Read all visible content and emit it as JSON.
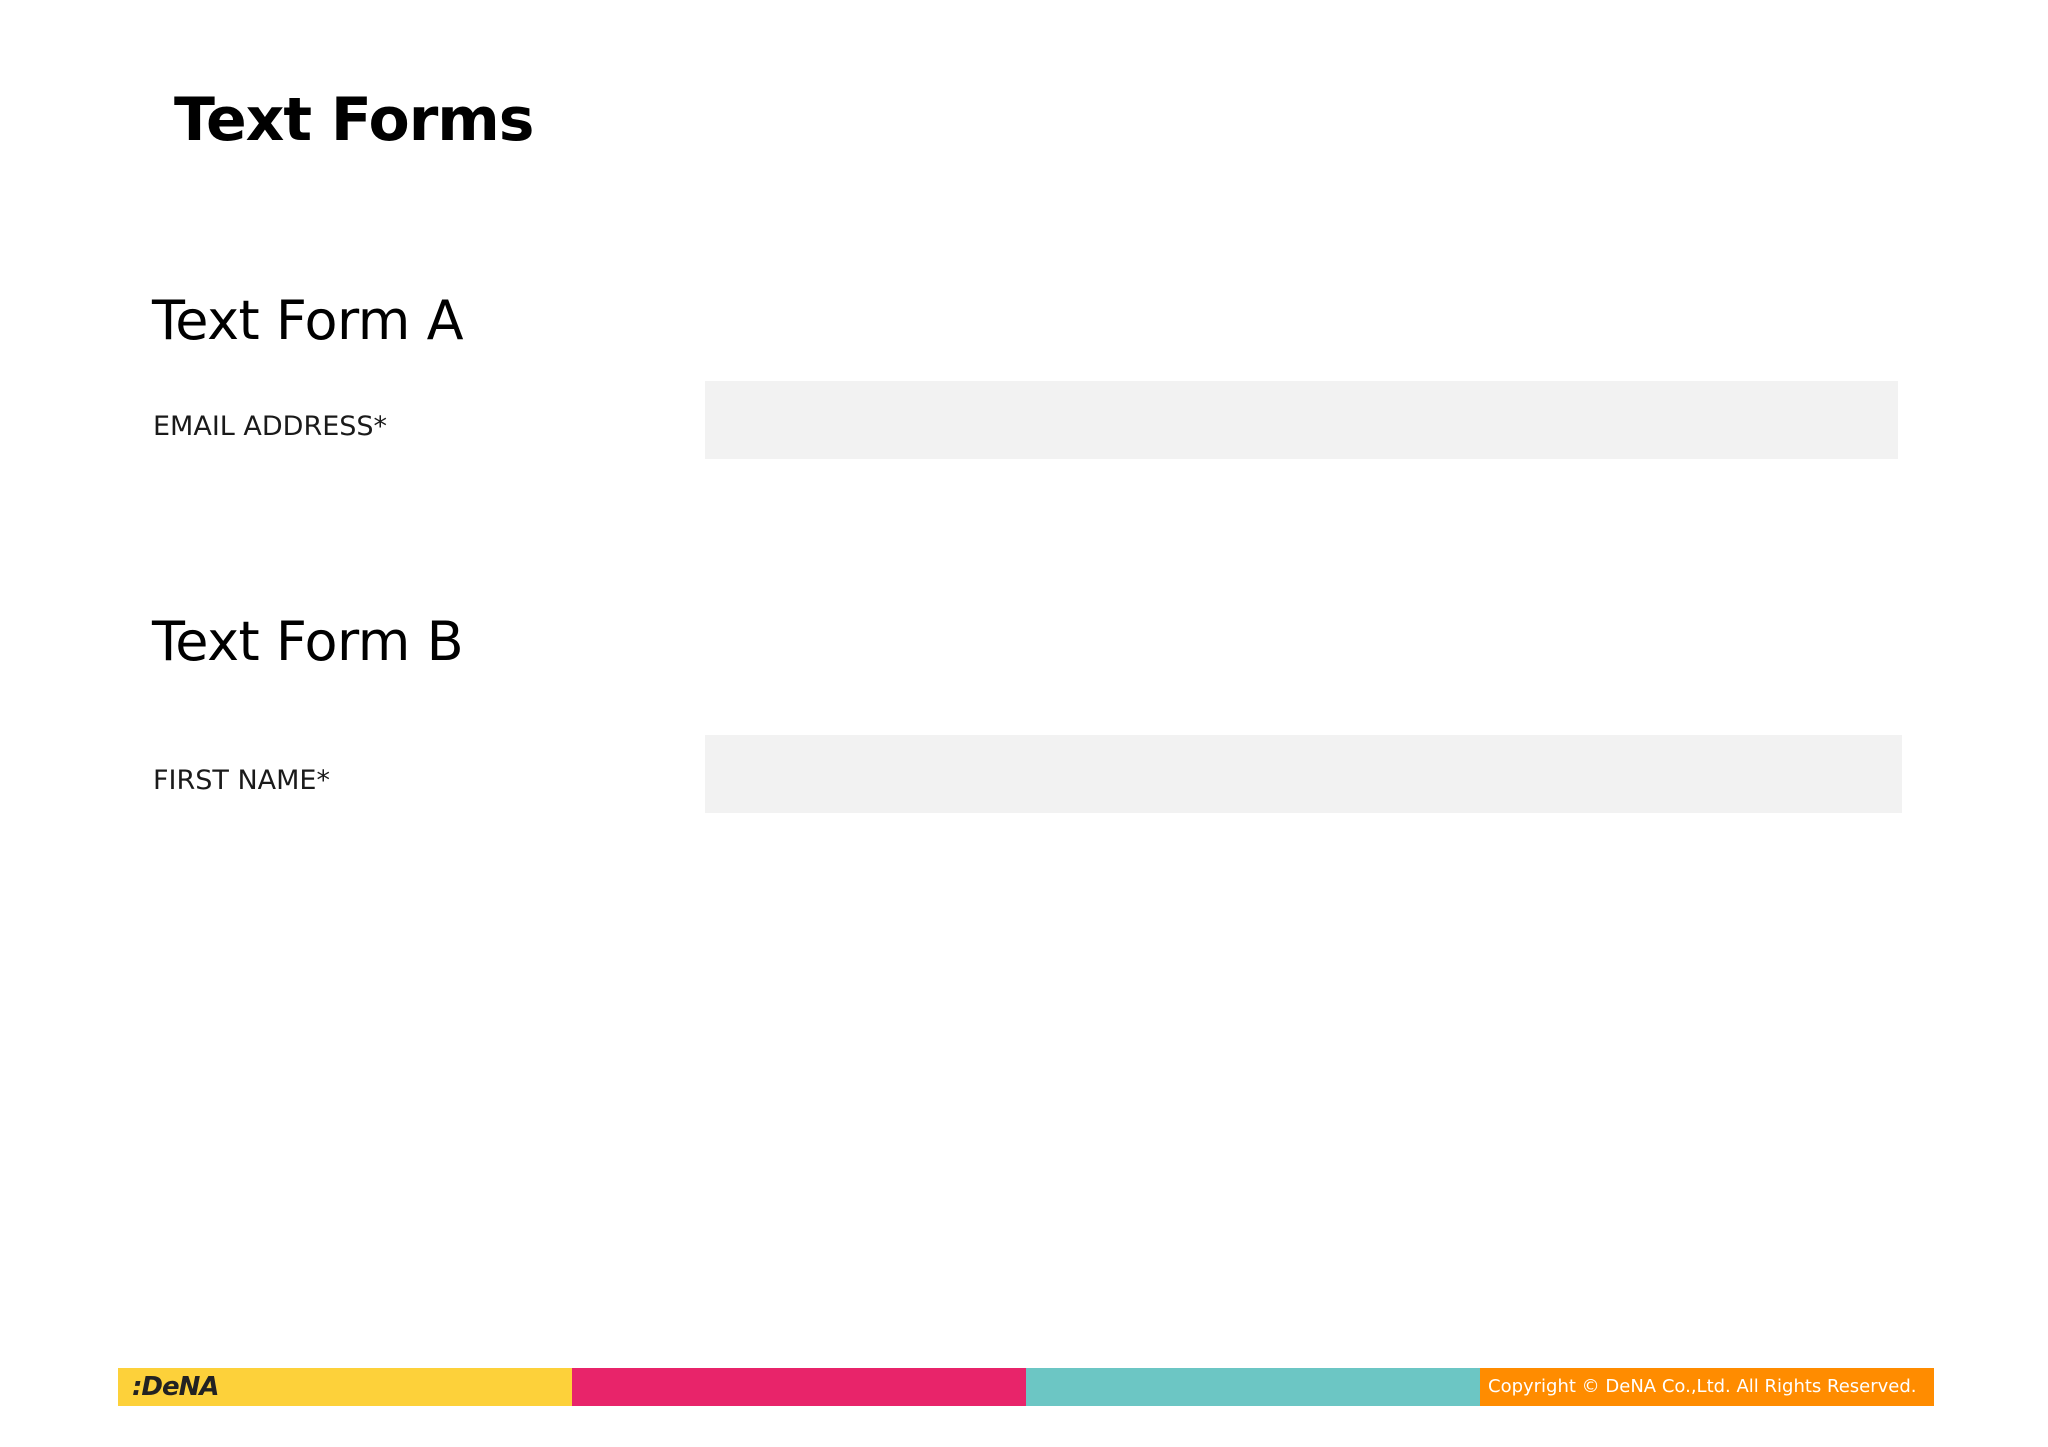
{
  "page": {
    "title": "Text Forms"
  },
  "sections": [
    {
      "title": "Text Form A",
      "field_label": "EMAIL ADDRESS*",
      "field_value": "",
      "field_placeholder": ""
    },
    {
      "title": "Text Form B",
      "field_label": "FIRST NAME*",
      "field_value": "",
      "field_placeholder": ""
    }
  ],
  "footer": {
    "logo_text": ":DeNA",
    "copyright": "Copyright © DeNA Co.,Ltd. All Rights Reserved.",
    "segment_colors": [
      "#fdd13a",
      "#e8246a",
      "#6cc6c4",
      "#ff8c00"
    ]
  },
  "colors": {
    "input_background": "#f2f2f2",
    "text": "#000000"
  }
}
